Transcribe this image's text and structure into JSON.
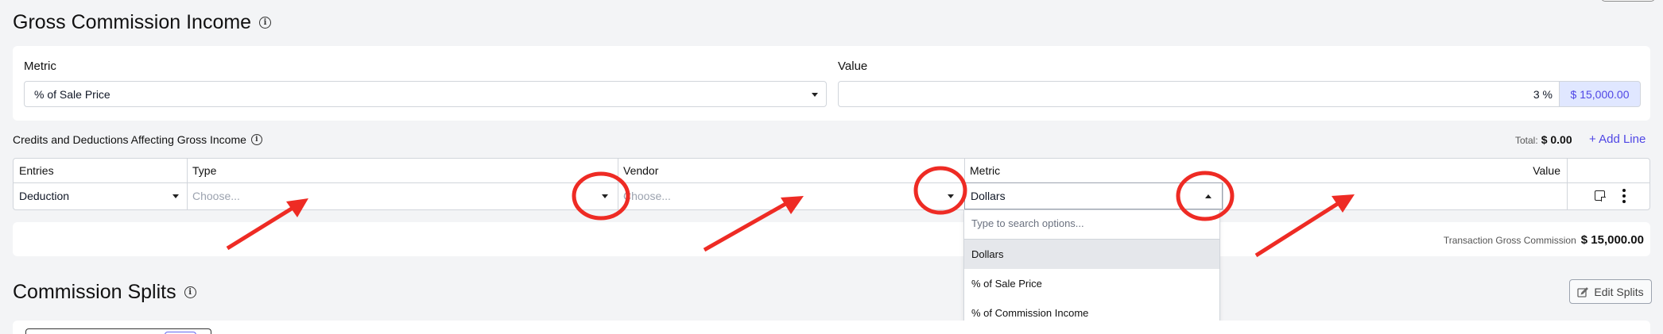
{
  "gci": {
    "title": "Gross Commission Income",
    "metric_label": "Metric",
    "metric_value": "% of Sale Price",
    "value_label": "Value",
    "value_input": "3 %",
    "value_amount": "$ 15,000.00"
  },
  "credits": {
    "title": "Credits and Deductions Affecting Gross Income",
    "total_label": "Total:",
    "total_value": "$ 0.00",
    "add_line": "+ Add Line",
    "columns": {
      "entries": "Entries",
      "type": "Type",
      "vendor": "Vendor",
      "metric": "Metric",
      "value": "Value"
    },
    "row": {
      "entries": "Deduction",
      "type_placeholder": "Choose...",
      "vendor_placeholder": "Choose...",
      "metric": "Dollars"
    },
    "dropdown": {
      "search_placeholder": "Type to search options...",
      "options": [
        "Dollars",
        "% of Sale Price",
        "% of Commission Income"
      ]
    }
  },
  "transaction": {
    "label": "Transaction Gross Commission",
    "value": "$ 15,000.00"
  },
  "splits": {
    "title": "Commission Splits",
    "edit_button": "Edit Splits"
  },
  "colors": {
    "accent": "#4f46e5",
    "annotation": "#ee2b24"
  }
}
